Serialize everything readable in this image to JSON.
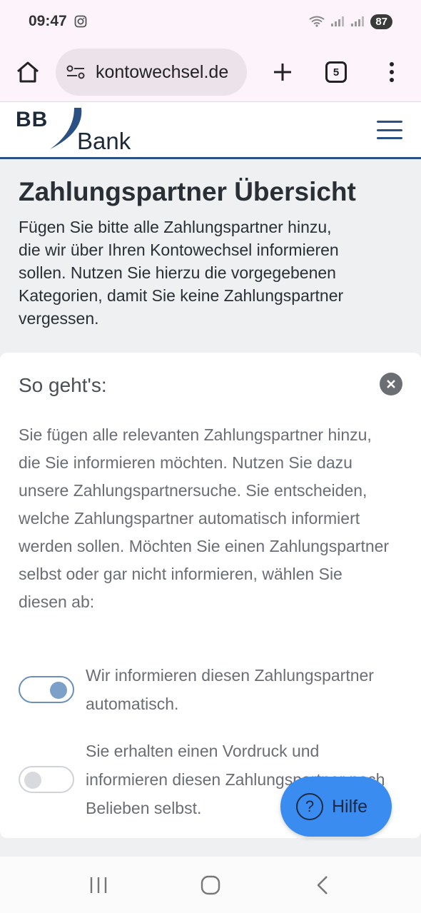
{
  "status_bar": {
    "time": "09:47",
    "battery": "87"
  },
  "browser": {
    "url": "kontowechsel.de",
    "tab_count": "5"
  },
  "header": {
    "logo_bb": "BB",
    "logo_bank": "Bank"
  },
  "intro": {
    "title": "Zahlungspartner Übersicht",
    "text": "Fügen Sie bitte alle Zahlungspartner hinzu, die wir über Ihren Kontowechsel informieren sollen. Nutzen Sie hierzu die vorgegebenen Kategorien, damit Sie keine Zahlungspartner vergessen."
  },
  "info_card": {
    "title": "So geht's:",
    "text": "Sie fügen alle relevanten Zahlungspartner hinzu, die Sie informieren möchten. Nutzen Sie dazu unsere Zahlungspartnersuche. Sie entscheiden, welche Zahlungspartner automatisch informiert werden sollen. Möchten Sie einen Zahlungspartner selbst oder gar nicht informieren, wählen Sie diesen ab:",
    "toggle_on_label": "Wir informieren diesen Zahlungspartner automatisch.",
    "toggle_off_label": "Sie erhalten einen Vordruck und informieren diesen Zahlungspartner nach Belieben selbst."
  },
  "help": {
    "label": "Hilfe"
  },
  "colors": {
    "brand": "#2b5082",
    "help_button": "#3a8cf0",
    "toggle_on": "#7da0c8"
  }
}
